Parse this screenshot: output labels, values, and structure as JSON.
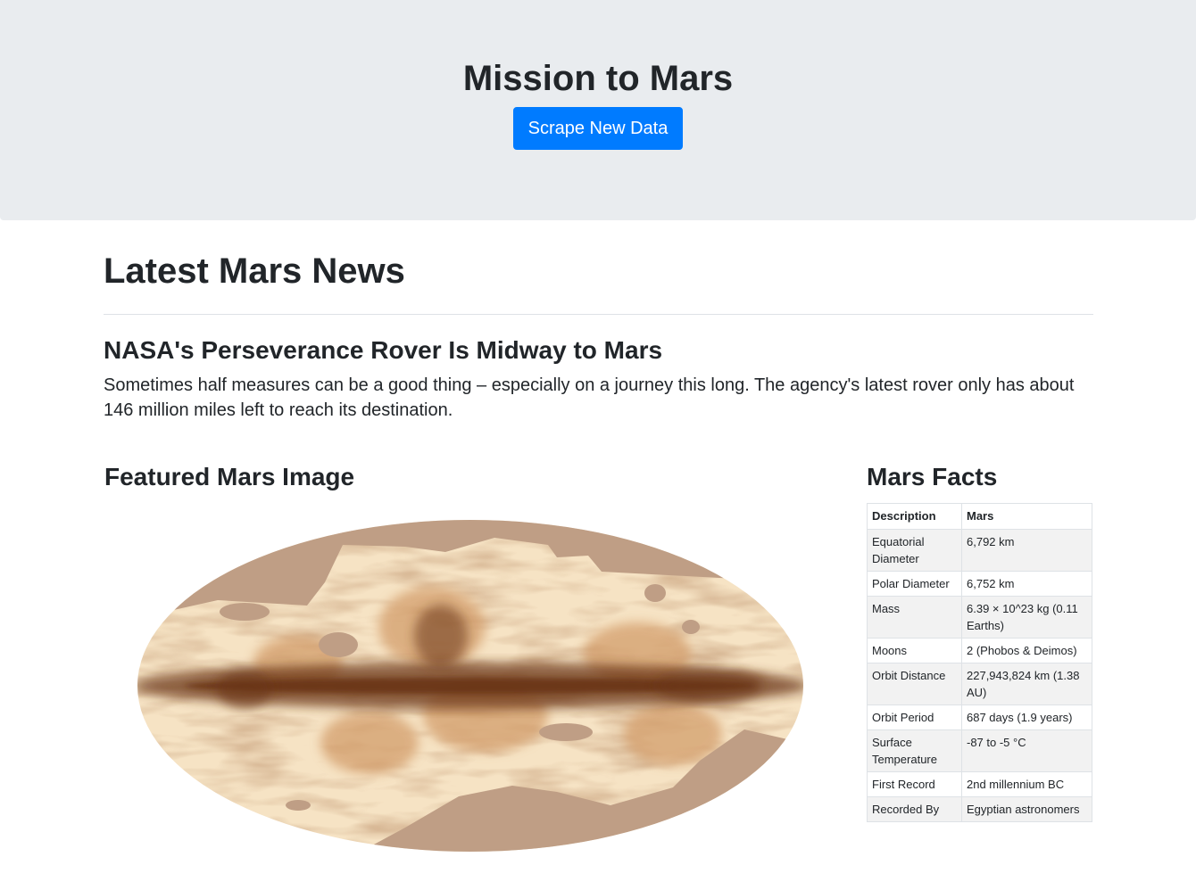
{
  "header": {
    "title": "Mission to Mars",
    "scrape_button_label": "Scrape New Data"
  },
  "news": {
    "section_heading": "Latest Mars News",
    "title": "NASA's Perseverance Rover Is Midway to Mars",
    "teaser": "Sometimes half measures can be a good thing – especially on a journey this long. The agency's latest rover only has about 146 million miles left to reach its destination."
  },
  "featured_image": {
    "heading": "Featured Mars Image",
    "icon": "mars-galaxy-map-image",
    "colors": {
      "mask": "#bf9e85",
      "pale": "#f6e3c4",
      "mid": "#d19a66",
      "dark": "#6a3418"
    }
  },
  "facts": {
    "heading": "Mars Facts",
    "columns": [
      "Description",
      "Mars"
    ],
    "rows": [
      [
        "Equatorial Diameter",
        "6,792 km"
      ],
      [
        "Polar Diameter",
        "6,752 km"
      ],
      [
        "Mass",
        "6.39 × 10^23 kg (0.11 Earths)"
      ],
      [
        "Moons",
        "2 (Phobos & Deimos)"
      ],
      [
        "Orbit Distance",
        "227,943,824 km (1.38 AU)"
      ],
      [
        "Orbit Period",
        "687 days (1.9 years)"
      ],
      [
        "Surface Temperature",
        "-87 to -5 °C"
      ],
      [
        "First Record",
        "2nd millennium BC"
      ],
      [
        "Recorded By",
        "Egyptian astronomers"
      ]
    ]
  },
  "theme": {
    "jumbotron_bg": "#e9ecef",
    "primary": "#007bff",
    "text": "#212529"
  }
}
